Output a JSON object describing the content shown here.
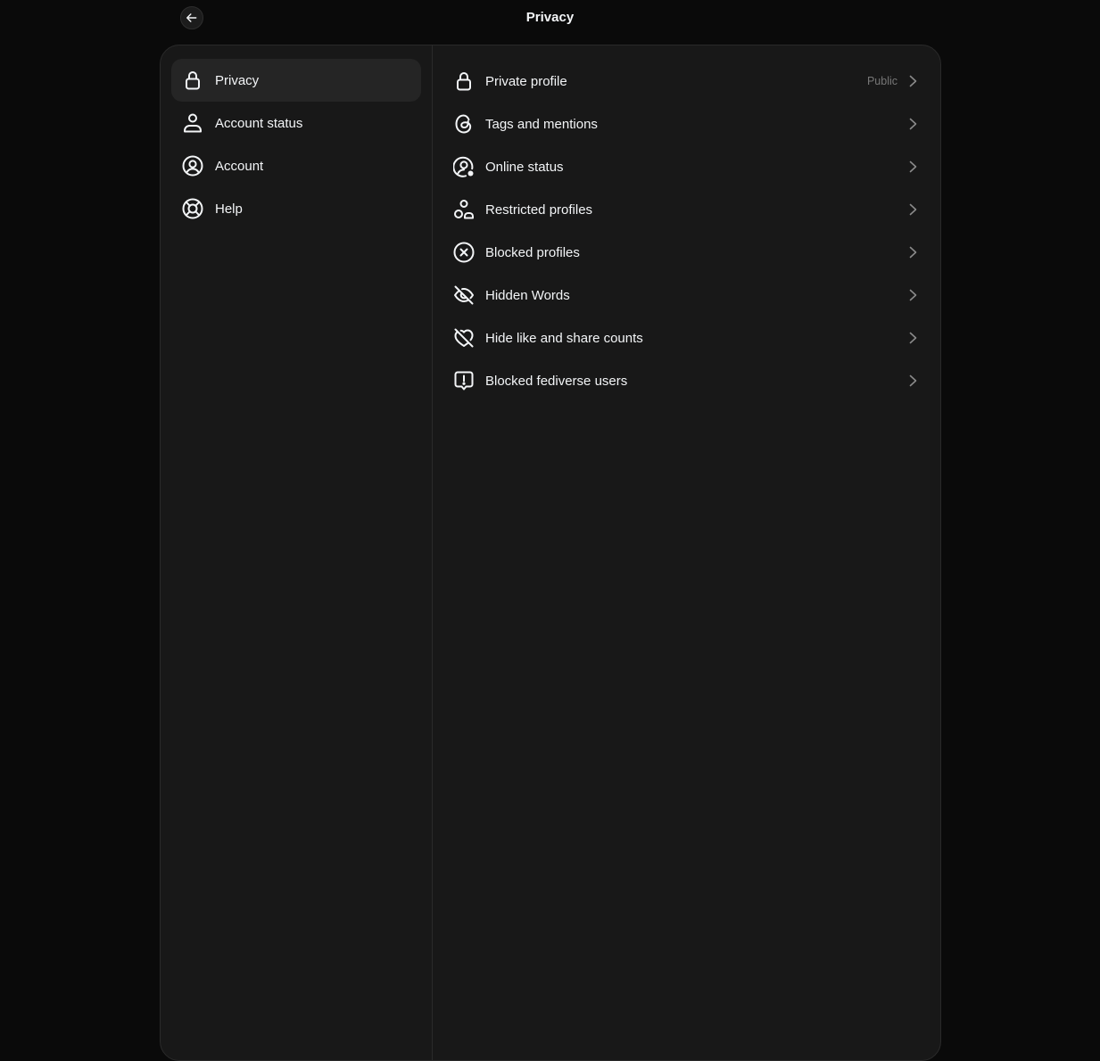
{
  "header": {
    "title": "Privacy"
  },
  "sidebar": {
    "items": [
      {
        "label": "Privacy",
        "icon": "lock-icon",
        "active": true
      },
      {
        "label": "Account status",
        "icon": "person-icon"
      },
      {
        "label": "Account",
        "icon": "account-circle-icon"
      },
      {
        "label": "Help",
        "icon": "lifebuoy-icon"
      }
    ]
  },
  "settings": {
    "items": [
      {
        "label": "Private profile",
        "value": "Public",
        "icon": "lock-icon"
      },
      {
        "label": "Tags and mentions",
        "icon": "threads-at-icon"
      },
      {
        "label": "Online status",
        "icon": "online-status-icon"
      },
      {
        "label": "Restricted profiles",
        "icon": "restricted-people-icon"
      },
      {
        "label": "Blocked profiles",
        "icon": "blocked-x-circle-icon"
      },
      {
        "label": "Hidden Words",
        "icon": "eye-off-icon"
      },
      {
        "label": "Hide like and share counts",
        "icon": "heart-off-icon"
      },
      {
        "label": "Blocked fediverse users",
        "icon": "alert-bubble-icon"
      }
    ]
  },
  "colors": {
    "background": "#0a0a0a",
    "panel": "#181818",
    "active_item": "#252525",
    "text": "#f3f5f7",
    "muted": "#777777"
  }
}
